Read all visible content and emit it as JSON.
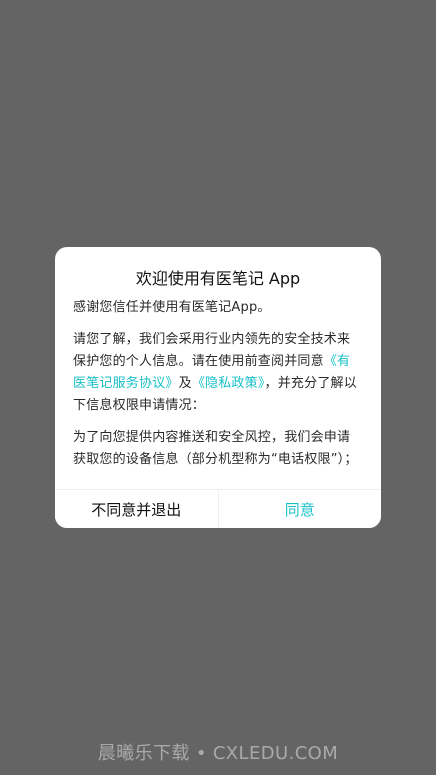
{
  "dialog": {
    "title": "欢迎使用有医笔记 App",
    "paragraphs": {
      "p1": "感谢您信任并使用有医笔记App。",
      "p2_a": "请您了解，我们会采用行业内领先的安全技术来保护您的个人信息。请在使用前查阅并同意",
      "p2_link1": "《有医笔记服务协议》",
      "p2_mid": "及",
      "p2_link2": "《隐私政策》",
      "p2_b": "，并充分了解以下信息权限申请情况：",
      "p3": "为了向您提供内容推送和安全风控，我们会申请获取您的设备信息（部分机型称为“电话权限”）；"
    },
    "buttons": {
      "disagree": "不同意并退出",
      "agree": "同意"
    }
  },
  "watermark": {
    "left": "晨曦乐下载",
    "dot": "•",
    "right": "CXLEDU.COM"
  },
  "colors": {
    "overlay": "#646464",
    "accent": "#19c1c8"
  }
}
